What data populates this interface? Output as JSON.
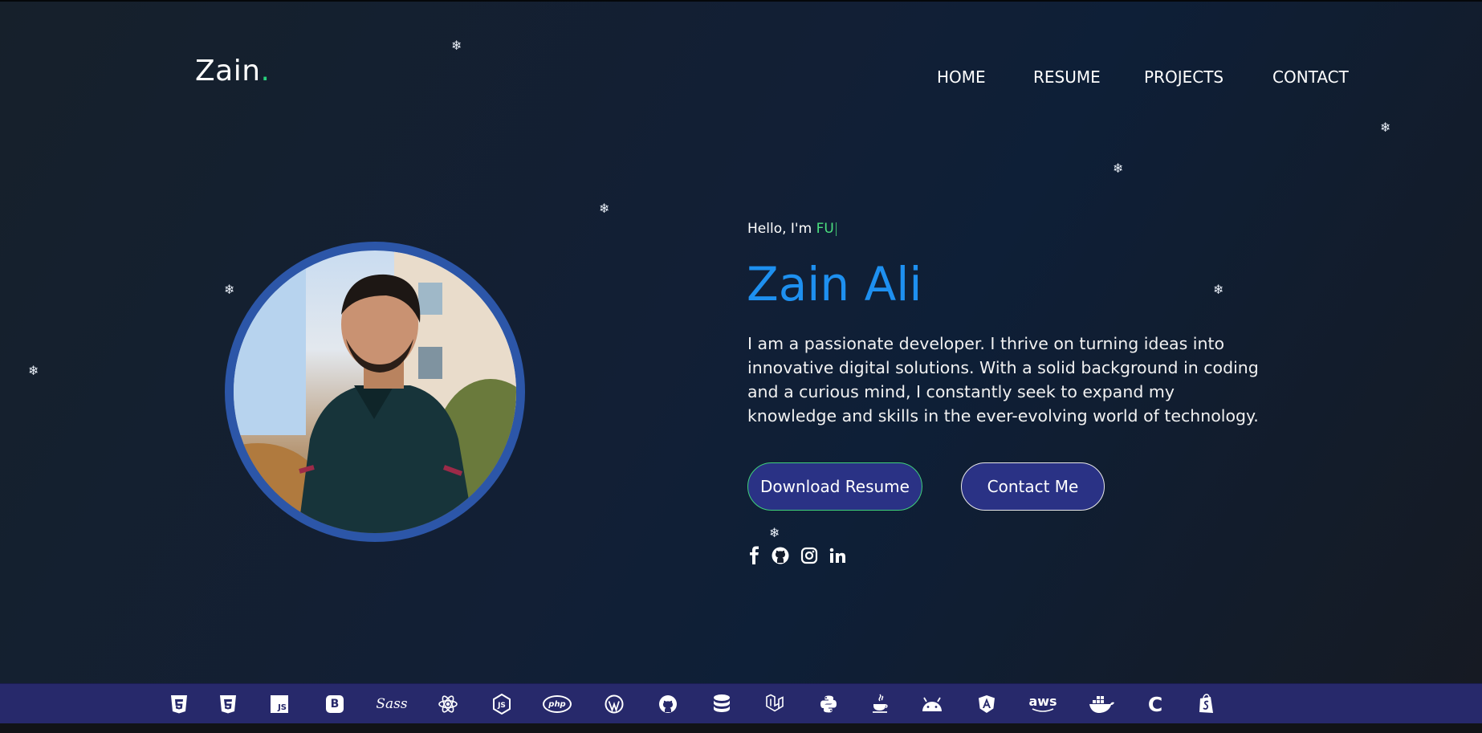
{
  "brand": {
    "name": "Zain",
    "dot": "."
  },
  "nav": {
    "items": [
      "HOME",
      "RESUME",
      "PROJECTS",
      "CONTACT"
    ]
  },
  "hero": {
    "greeting": "Hello, I'm",
    "typed_text": "FU",
    "cursor": "|",
    "name": "Zain Ali",
    "bio": "I am a passionate developer. I thrive on turning ideas into innovative digital solutions. With a solid background in coding and a curious mind, I constantly seek to expand my knowledge and skills in the ever-evolving world of technology.",
    "photo": "profile-photo"
  },
  "buttons": {
    "download_resume": "Download Resume",
    "contact_me": "Contact Me"
  },
  "social": [
    "facebook-icon",
    "github-icon",
    "instagram-icon",
    "linkedin-icon"
  ],
  "snowflake": "❄",
  "skills": [
    "html5-icon",
    "css3-icon",
    "javascript-icon",
    "bootstrap-icon",
    "sass-icon",
    "react-icon",
    "nodejs-icon",
    "php-icon",
    "wordpress-icon",
    "github-icon",
    "database-icon",
    "laravel-icon",
    "python-icon",
    "java-icon",
    "android-icon",
    "angular-icon",
    "aws-icon",
    "docker-icon",
    "c-icon",
    "shopify-icon"
  ],
  "skill_labels": {
    "js": "JS",
    "bootstrap": "B",
    "sass": "Sass",
    "php": "php",
    "aws": "aws",
    "c": "C"
  },
  "colors": {
    "accent_green": "#28d17c",
    "name_blue": "#1e90f0",
    "button_bg": "#2a3285",
    "photo_ring": "#2c56a8",
    "skills_bar": "#27296b"
  }
}
